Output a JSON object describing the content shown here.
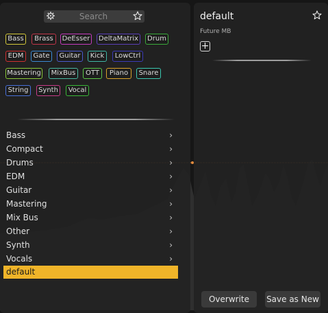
{
  "search": {
    "placeholder": "Search"
  },
  "tags": [
    {
      "label": "Bass",
      "color": "#d4c93a"
    },
    {
      "label": "Brass",
      "color": "#c2364a"
    },
    {
      "label": "DeEsser",
      "color": "#c83cc0"
    },
    {
      "label": "DeltaMatrix",
      "color": "#5a3fb8"
    },
    {
      "label": "Drum",
      "color": "#3aaa3a"
    },
    {
      "label": "EDM",
      "color": "#d03030"
    },
    {
      "label": "Gate",
      "color": "#3a8ad4"
    },
    {
      "label": "Guitar",
      "color": "#4a5ad0"
    },
    {
      "label": "Kick",
      "color": "#3fb8a8"
    },
    {
      "label": "LowCtrl",
      "color": "#3a3ab8"
    },
    {
      "label": "Mastering",
      "color": "#8ac838"
    },
    {
      "label": "MixBus",
      "color": "#48b8a0"
    },
    {
      "label": "OTT",
      "color": "#5cc848"
    },
    {
      "label": "Piano",
      "color": "#d8a22a"
    },
    {
      "label": "Snare",
      "color": "#3ac8b0"
    },
    {
      "label": "String",
      "color": "#4870d8"
    },
    {
      "label": "Synth",
      "color": "#c83c88"
    },
    {
      "label": "Vocal",
      "color": "#3ab838"
    }
  ],
  "categories": [
    "Bass",
    "Compact",
    "Drums",
    "EDM",
    "Guitar",
    "Mastering",
    "Mix Bus",
    "Other",
    "Synth",
    "Vocals"
  ],
  "selected_preset": "default",
  "right": {
    "title": "default",
    "subtitle": "Future MB",
    "add_label": "+",
    "overwrite_label": "Overwrite",
    "save_as_new_label": "Save as New"
  },
  "colors": {
    "accent": "#f0b429",
    "marker": "#c0703a"
  },
  "icons": {
    "settings": "gear-icon",
    "favorite": "star-icon",
    "submenu": "chevron-right-icon",
    "add": "plus-icon"
  }
}
